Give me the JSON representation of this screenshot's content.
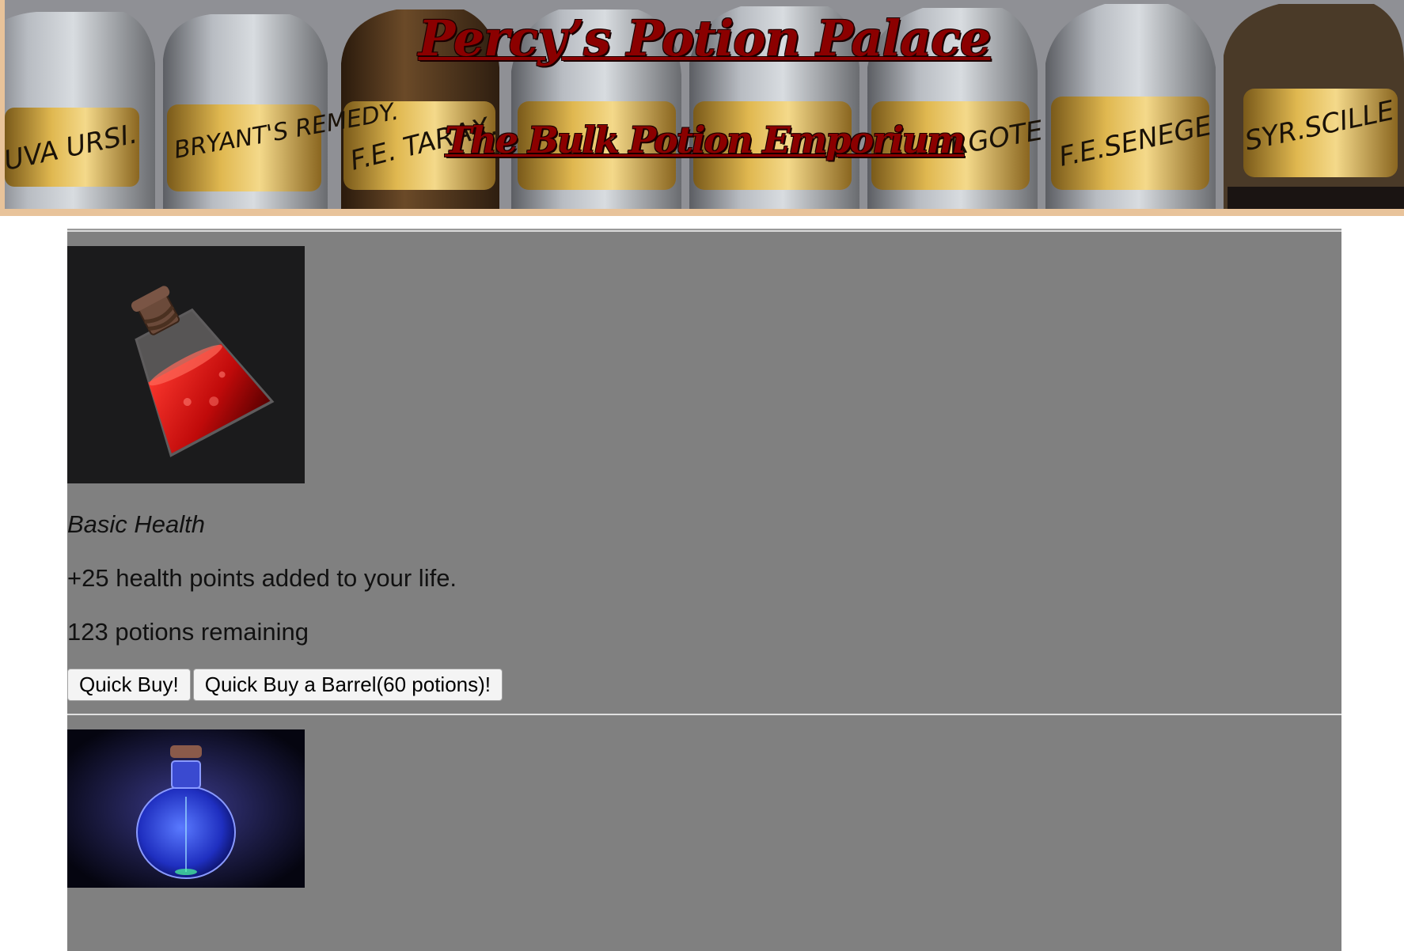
{
  "header": {
    "title": "Percy’s Potion Palace",
    "subtitle": "The Bulk Potion Emporium",
    "bottle_labels": [
      "UVA URSI.",
      "BRYANT'S REMEDY.",
      "F.E. TARAX.",
      "",
      "",
      "ERGOTE",
      "F.E.SENEGE",
      "SYR.SCILLE"
    ]
  },
  "products": [
    {
      "name": "Basic Health",
      "description": "+25 health points added to your life.",
      "stock": "123 potions remaining",
      "buy_label": "Quick Buy!",
      "barrel_label": "Quick Buy a Barrel(60 potions)!",
      "image_icon": "red-health-potion-icon",
      "color": "#d01010"
    },
    {
      "image_icon": "blue-mana-potion-icon",
      "color": "#2a3bd8"
    }
  ],
  "colors": {
    "title": "#8b0000",
    "banner_border": "#e8c39a",
    "card_bg": "#808080"
  }
}
